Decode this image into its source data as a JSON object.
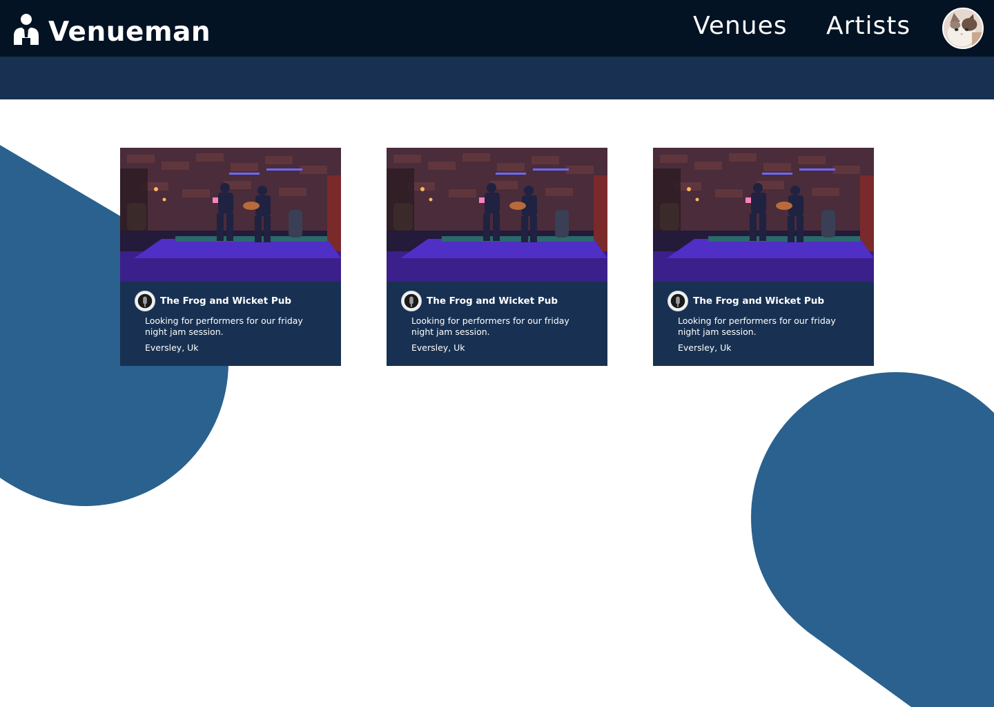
{
  "app": {
    "brand_name": "Venueman",
    "brand_icon": "person-icon"
  },
  "nav": {
    "venues_label": "Venues",
    "artists_label": "Artists",
    "avatar_icon": "user-avatar"
  },
  "colors": {
    "topbar": "#031323",
    "subbar": "#183152",
    "card_background": "#183152",
    "blob": "#2a618e",
    "text": "#ffffff"
  },
  "listings": [
    {
      "venue_name": "The Frog and Wicket Pub",
      "description": "Looking for performers for our friday night jam session.",
      "location": "Eversley, Uk",
      "photo": "live-music-stage-photo"
    },
    {
      "venue_name": "The Frog and Wicket Pub",
      "description": "Looking for performers for our friday night jam session.",
      "location": "Eversley, Uk",
      "photo": "live-music-stage-photo"
    },
    {
      "venue_name": "The Frog and Wicket Pub",
      "description": "Looking for performers for our friday night jam session.",
      "location": "Eversley, Uk",
      "photo": "live-music-stage-photo"
    }
  ]
}
